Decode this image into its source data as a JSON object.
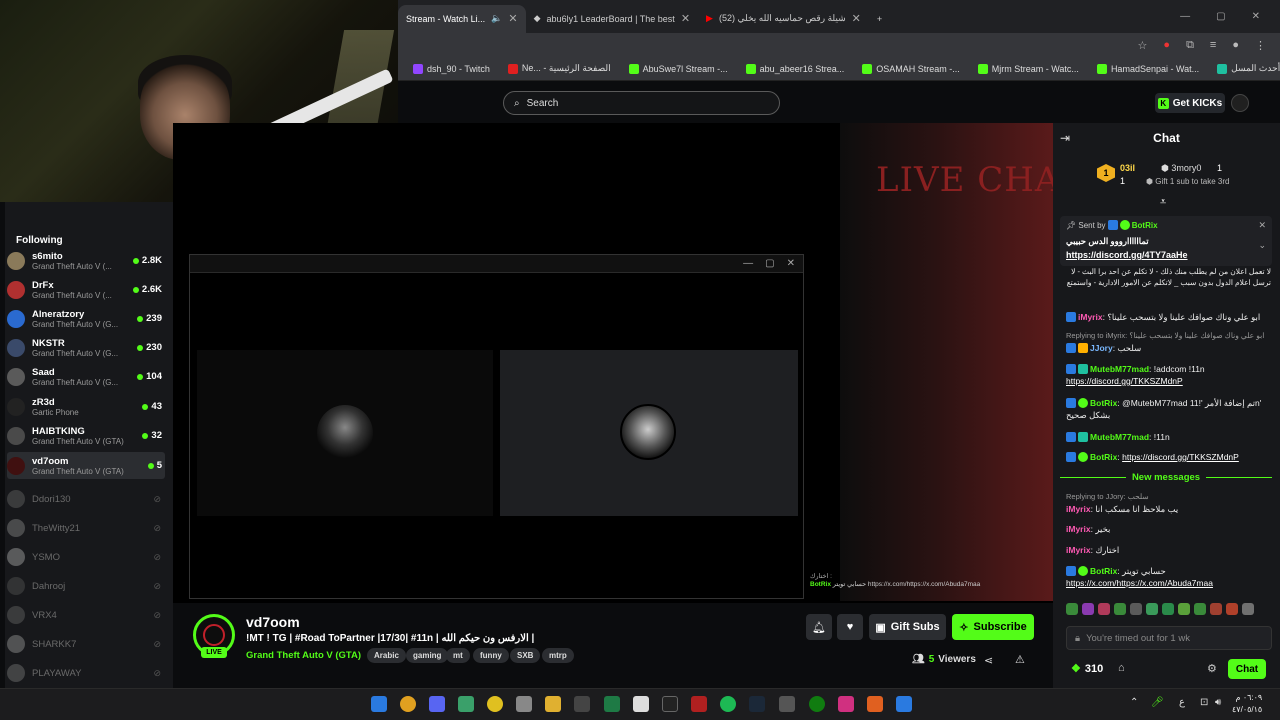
{
  "browser": {
    "tabs": [
      {
        "label": "Stream - Watch Li..."
      },
      {
        "label": "abu6ly1 LeaderBoard | The best"
      },
      {
        "label": "(52) شيلة رقص حماسيه الله يخلي"
      }
    ],
    "new_tab_label": "+",
    "bookmarks": [
      {
        "label": "dsh_90 - Twitch",
        "color": "#9146ff"
      },
      {
        "label": "Ne... - الصفحة الرئيسية",
        "color": "#e02020"
      },
      {
        "label": "AbuSwe7l Stream -...",
        "color": "#53fc18"
      },
      {
        "label": "abu_abeer16 Strea...",
        "color": "#53fc18"
      },
      {
        "label": "OSAMAH Stream -...",
        "color": "#53fc18"
      },
      {
        "label": "Mjrm Stream - Watc...",
        "color": "#53fc18"
      },
      {
        "label": "HamadSenpai - Wat...",
        "color": "#53fc18"
      },
      {
        "label": "شاهد | أحدث المسل...",
        "color": "#1fc0a0"
      }
    ]
  },
  "header": {
    "search_placeholder": "Search",
    "get_kicks_label": "Get KICKs"
  },
  "sidebar": {
    "heading": "Following",
    "channels": [
      {
        "name": "s6mito",
        "game": "Grand Theft Auto V (...",
        "viewers": "2.8K",
        "color": "#8a7a5a"
      },
      {
        "name": "DrFx",
        "game": "Grand Theft Auto V (...",
        "viewers": "2.6K",
        "color": "#b03030"
      },
      {
        "name": "Alneratzory",
        "game": "Grand Theft Auto V (G...",
        "viewers": "239",
        "color": "#2a6ad0"
      },
      {
        "name": "NKSTR",
        "game": "Grand Theft Auto V (G...",
        "viewers": "230",
        "color": "#3a4a6a"
      },
      {
        "name": "Saad",
        "game": "Grand Theft Auto V (G...",
        "viewers": "104",
        "color": "#5a5a5a"
      },
      {
        "name": "zR3d",
        "game": "Gartic Phone",
        "viewers": "43",
        "color": "#222"
      },
      {
        "name": "HAIBTKING",
        "game": "Grand Theft Auto V (GTA)",
        "viewers": "32",
        "color": "#4a4a4a"
      },
      {
        "name": "vd7oom",
        "game": "Grand Theft Auto V (GTA)",
        "viewers": "5",
        "color": "#401010"
      }
    ],
    "offline": [
      {
        "name": "Ddori130",
        "color": "#666"
      },
      {
        "name": "TheWitty21",
        "color": "#888"
      },
      {
        "name": "YSMO",
        "color": "#aaa"
      },
      {
        "name": "Dahrooj",
        "color": "#555"
      },
      {
        "name": "VRX4",
        "color": "#666"
      },
      {
        "name": "SHARKK7",
        "color": "#999"
      },
      {
        "name": "PLAYAWAY",
        "color": "#777"
      }
    ]
  },
  "video": {
    "poster_text": "LIVE CHAT",
    "overlay_line1": "اختارك :",
    "overlay_user": "BotRix",
    "overlay_text": "حسابي تويتر https://x.com/https://x.com/Abuda7maa"
  },
  "stream": {
    "streamer": "vd7oom",
    "live_label": "LIVE",
    "title": "!MT ! TG | #Road ToPartner |17/30| #11n | الارفس ون حيكم الله |",
    "game": "Grand Theft Auto V (GTA)",
    "tags": [
      "Arabic",
      "gaming",
      "mt",
      "funny",
      "SXB",
      "mtrp"
    ],
    "gift_subs_label": "Gift Subs",
    "subscribe_label": "Subscribe",
    "viewers_count": "5",
    "viewers_label": "Viewers"
  },
  "chat": {
    "header": "Chat",
    "leader": {
      "first_name": "03il",
      "first_count": "1",
      "second_name": "3mory0",
      "second_count": "1",
      "gift_label": "Gift 1 sub to take 3rd"
    },
    "pinned": {
      "sent_by_label": "Sent by",
      "sender": "BotRix",
      "text": "تماااااارووو الدس حبيبي",
      "link": "https://discord.gg/4TY7aaHe"
    },
    "rules_text": "لا تعمل اعلان من لم يطلب منك ذلك - لا تكلم عن احد برا البث - لا ترسل اعلام الدول بدون سبب _ لاتكلم عن الامور الادارية - واستمتع",
    "messages": [
      {
        "user": "iMyrix",
        "text": "ابو علي وناك صوافك علينا ولا بتسحب علينا؟"
      },
      {
        "reply": "Replying to iMyrix: ابو علي وناك صوافك علينا ولا بتسحب علينا؟",
        "user": "JJory",
        "text": "سلحب"
      },
      {
        "user": "MutebM77mad",
        "text": "!addcom !11n",
        "link": "https://discord.gg/TKKSZMdnP"
      },
      {
        "user": "BotRix",
        "text": "@MutebM77mad تم إضافة الأمر '!11n' بشكل صحيح"
      },
      {
        "user": "MutebM77mad",
        "text": "!11n"
      },
      {
        "user": "BotRix",
        "link": "https://discord.gg/TKKSZMdnP"
      }
    ],
    "new_messages_label": "New messages",
    "new_messages": [
      {
        "reply": "Replying to JJory: سلحب",
        "user": "iMyrix",
        "text": "يب ملاحظ انا مسكب انا"
      },
      {
        "user": "iMyrix",
        "text": "بخير"
      },
      {
        "user": "iMyrix",
        "text": "اختارك"
      },
      {
        "user": "BotRix",
        "text": "حسابي تويتر",
        "link": "https://x.com/https://x.com/Abuda7maa"
      }
    ],
    "input_placeholder": "You're timed out for 1 wk",
    "points": "310",
    "chat_button": "Chat"
  },
  "taskbar": {
    "time": "٠٦:٠٩ م",
    "date": "٤٧/٠٥/١٥",
    "lang": "ع"
  }
}
